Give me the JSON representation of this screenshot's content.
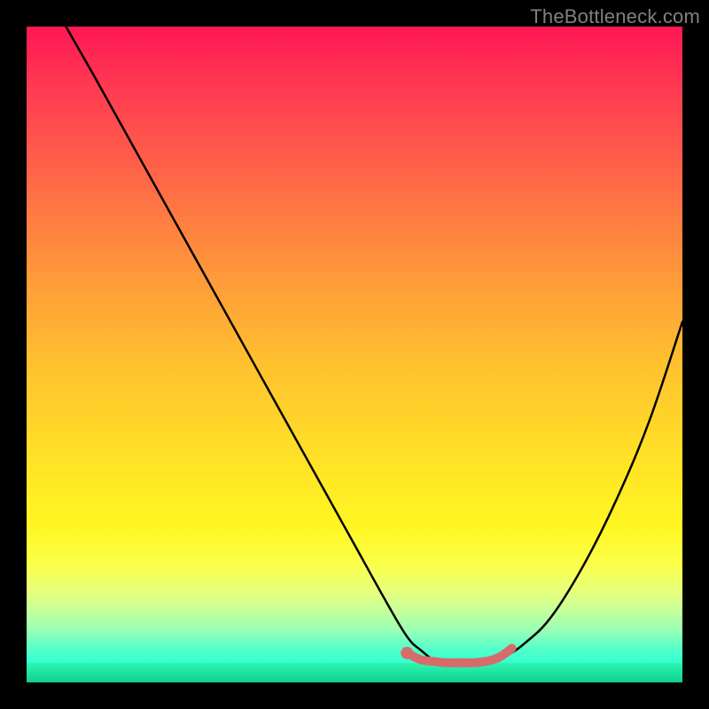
{
  "watermark": "TheBottleneck.com",
  "chart_data": {
    "type": "line",
    "title": "",
    "xlabel": "",
    "ylabel": "",
    "xlim": [
      0,
      100
    ],
    "ylim": [
      0,
      100
    ],
    "grid": false,
    "legend": false,
    "series": [
      {
        "name": "bottleneck-curve",
        "color": "#000000",
        "x": [
          6,
          10,
          15,
          20,
          25,
          30,
          35,
          40,
          45,
          50,
          55,
          58,
          60,
          63,
          67,
          70,
          73,
          76,
          80,
          85,
          90,
          95,
          100
        ],
        "y": [
          100,
          93,
          84,
          75,
          66,
          57,
          48,
          39,
          30,
          21,
          12,
          7,
          5,
          3,
          3,
          3,
          4,
          6,
          10,
          18,
          28,
          40,
          55
        ]
      },
      {
        "name": "optimal-range-marker",
        "color": "#d66b6b",
        "x": [
          58,
          60,
          62,
          64,
          66,
          68,
          70,
          72,
          74
        ],
        "y": [
          4.5,
          3.5,
          3.2,
          3.0,
          3.0,
          3.0,
          3.2,
          3.8,
          5.2
        ]
      }
    ],
    "annotations": [
      {
        "text": "TheBottleneck.com",
        "position": "top-right"
      }
    ]
  }
}
